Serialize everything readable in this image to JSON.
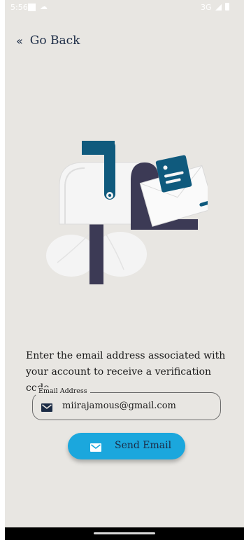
{
  "status_bar": {
    "time": "5:56",
    "network": "3G",
    "cloud_glyph": "☁"
  },
  "header": {
    "back_icon": "«",
    "back_label": "Go Back"
  },
  "illustration": {
    "name": "mailbox-with-envelope",
    "colors": {
      "primary": "#0f5a7d",
      "dark": "#3c3a55",
      "light": "#f5f5f5"
    }
  },
  "description": "Enter the email address associated with your account to receive a verification code.",
  "email_field": {
    "label": "Email Address",
    "value": "miirajamous@gmail.com"
  },
  "send_button": {
    "label": "Send Email",
    "color": "#1ba7dd"
  }
}
